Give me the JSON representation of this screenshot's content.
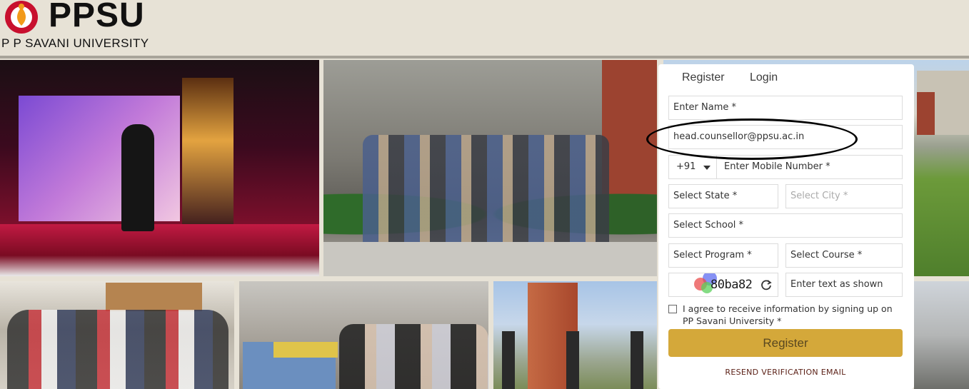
{
  "header": {
    "logo_text": "PPSU",
    "logo_subtitle": "P P SAVANI UNIVERSITY"
  },
  "form": {
    "tabs": [
      {
        "label": "Register"
      },
      {
        "label": "Login"
      }
    ],
    "name_placeholder": "Enter Name *",
    "email_value": "head.counsellor@ppsu.ac.in",
    "country_code": "+91",
    "mobile_placeholder": "Enter Mobile Number *",
    "state_placeholder": "Select State *",
    "city_placeholder": "Select City *",
    "school_placeholder": "Select School *",
    "program_placeholder": "Select Program *",
    "course_placeholder": "Select Course *",
    "captcha_code": "80ba82",
    "captcha_input_placeholder": "Enter text as shown",
    "agree_text": "I agree to receive information by signing up on PP Savani University *",
    "register_button": "Register",
    "resend_link": "RESEND VERIFICATION EMAIL"
  },
  "colors": {
    "accent": "#d4a83a",
    "background": "#e7e2d6"
  }
}
